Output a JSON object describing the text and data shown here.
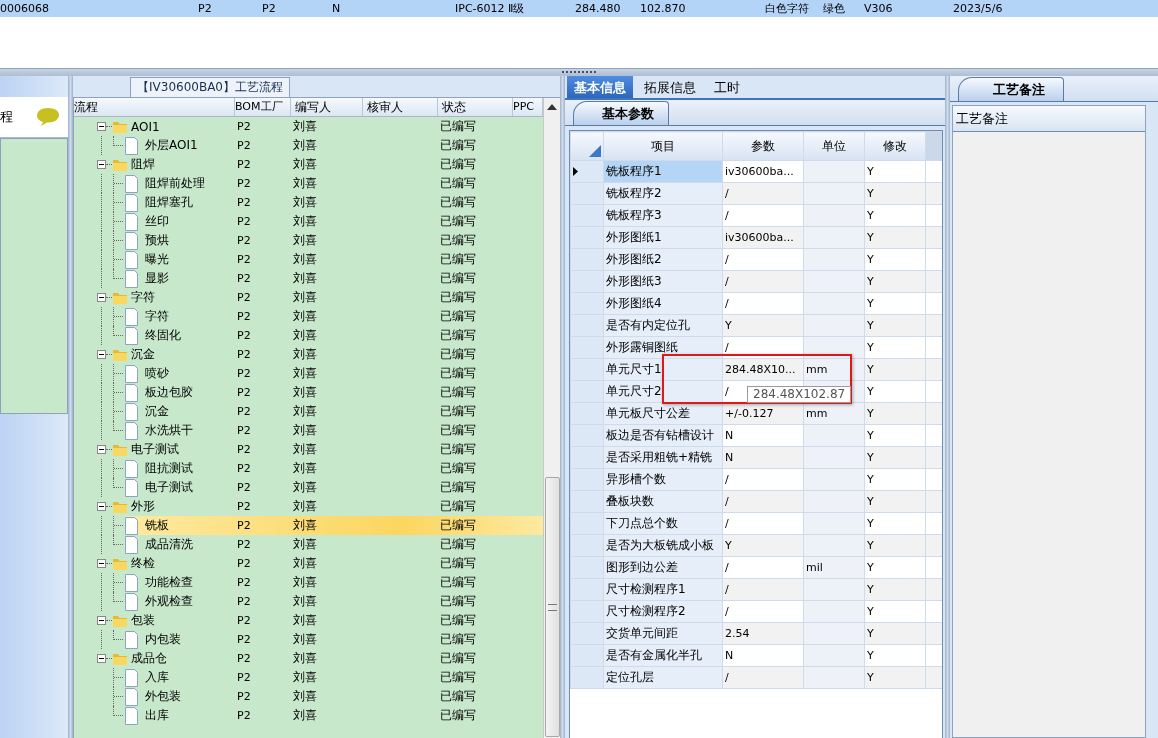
{
  "top_record": {
    "cells": [
      "0006068",
      "P2",
      "P2",
      "N",
      "IPC-6012 Ⅱ级",
      "284.480",
      "102.870",
      "白色字符",
      "绿色",
      "V306",
      "2023/5/6"
    ]
  },
  "side_panel": {
    "title": "程"
  },
  "process_tree": {
    "title": "【IV30600BA0】工艺流程",
    "columns": [
      "流程",
      "BOM工厂",
      "编写人",
      "核审人",
      "状态",
      "PPC"
    ],
    "rows": [
      {
        "name": "AOI1",
        "bom": "P2",
        "author": "刘喜",
        "status": "已编写",
        "expanded": true,
        "selected": false,
        "children": [
          {
            "name": "外层AOI1",
            "bom": "P2",
            "author": "刘喜",
            "status": "已编写",
            "selected": false
          }
        ]
      },
      {
        "name": "阻焊",
        "bom": "P2",
        "author": "刘喜",
        "status": "已编写",
        "expanded": true,
        "selected": false,
        "children": [
          {
            "name": "阻焊前处理",
            "bom": "P2",
            "author": "刘喜",
            "status": "已编写",
            "selected": false
          },
          {
            "name": "阻焊塞孔",
            "bom": "P2",
            "author": "刘喜",
            "status": "已编写",
            "selected": false
          },
          {
            "name": "丝印",
            "bom": "P2",
            "author": "刘喜",
            "status": "已编写",
            "selected": false
          },
          {
            "name": "预烘",
            "bom": "P2",
            "author": "刘喜",
            "status": "已编写",
            "selected": false
          },
          {
            "name": "曝光",
            "bom": "P2",
            "author": "刘喜",
            "status": "已编写",
            "selected": false
          },
          {
            "name": "显影",
            "bom": "P2",
            "author": "刘喜",
            "status": "已编写",
            "selected": false
          }
        ]
      },
      {
        "name": "字符",
        "bom": "P2",
        "author": "刘喜",
        "status": "已编写",
        "expanded": true,
        "selected": false,
        "children": [
          {
            "name": "字符",
            "bom": "P2",
            "author": "刘喜",
            "status": "已编写",
            "selected": false
          },
          {
            "name": "终固化",
            "bom": "P2",
            "author": "刘喜",
            "status": "已编写",
            "selected": false
          }
        ]
      },
      {
        "name": "沉金",
        "bom": "P2",
        "author": "刘喜",
        "status": "已编写",
        "expanded": true,
        "selected": false,
        "children": [
          {
            "name": "喷砂",
            "bom": "P2",
            "author": "刘喜",
            "status": "已编写",
            "selected": false
          },
          {
            "name": "板边包胶",
            "bom": "P2",
            "author": "刘喜",
            "status": "已编写",
            "selected": false
          },
          {
            "name": "沉金",
            "bom": "P2",
            "author": "刘喜",
            "status": "已编写",
            "selected": false
          },
          {
            "name": "水洗烘干",
            "bom": "P2",
            "author": "刘喜",
            "status": "已编写",
            "selected": false
          }
        ]
      },
      {
        "name": "电子测试",
        "bom": "P2",
        "author": "刘喜",
        "status": "已编写",
        "expanded": true,
        "selected": false,
        "children": [
          {
            "name": "阻抗测试",
            "bom": "P2",
            "author": "刘喜",
            "status": "已编写",
            "selected": false
          },
          {
            "name": "电子测试",
            "bom": "P2",
            "author": "刘喜",
            "status": "已编写",
            "selected": false
          }
        ]
      },
      {
        "name": "外形",
        "bom": "P2",
        "author": "刘喜",
        "status": "已编写",
        "expanded": true,
        "selected": false,
        "children": [
          {
            "name": "铣板",
            "bom": "P2",
            "author": "刘喜",
            "status": "已编写",
            "selected": true
          },
          {
            "name": "成品清洗",
            "bom": "P2",
            "author": "刘喜",
            "status": "已编写",
            "selected": false
          }
        ]
      },
      {
        "name": "终检",
        "bom": "P2",
        "author": "刘喜",
        "status": "已编写",
        "expanded": true,
        "selected": false,
        "children": [
          {
            "name": "功能检查",
            "bom": "P2",
            "author": "刘喜",
            "status": "已编写",
            "selected": false
          },
          {
            "name": "外观检查",
            "bom": "P2",
            "author": "刘喜",
            "status": "已编写",
            "selected": false
          }
        ]
      },
      {
        "name": "包装",
        "bom": "P2",
        "author": "刘喜",
        "status": "已编写",
        "expanded": true,
        "selected": false,
        "children": [
          {
            "name": "内包装",
            "bom": "P2",
            "author": "刘喜",
            "status": "已编写",
            "selected": false
          }
        ]
      },
      {
        "name": "成品仓",
        "bom": "P2",
        "author": "刘喜",
        "status": "已编写",
        "expanded": true,
        "selected": false,
        "children": [
          {
            "name": "入库",
            "bom": "P2",
            "author": "刘喜",
            "status": "已编写",
            "selected": false
          },
          {
            "name": "外包装",
            "bom": "P2",
            "author": "刘喜",
            "status": "已编写",
            "selected": false
          },
          {
            "name": "出库",
            "bom": "P2",
            "author": "刘喜",
            "status": "已编写",
            "selected": false
          }
        ]
      }
    ]
  },
  "main_tabs": [
    {
      "label": "基本信息",
      "selected": true
    },
    {
      "label": "拓展信息",
      "selected": false
    },
    {
      "label": "工时",
      "selected": false
    }
  ],
  "basic_params": {
    "tab": "基本参数",
    "columns": [
      "项目",
      "参数",
      "单位",
      "修改"
    ],
    "rows": [
      {
        "item": "铣板程序1",
        "value": "iv30600ba...",
        "modified": "Y",
        "selected": true
      },
      {
        "item": "铣板程序2",
        "value": "/",
        "modified": "Y",
        "selected": false
      },
      {
        "item": "铣板程序3",
        "value": "/",
        "modified": "Y",
        "selected": false
      },
      {
        "item": "外形图纸1",
        "value": "iv30600ba...",
        "modified": "Y",
        "selected": false
      },
      {
        "item": "外形图纸2",
        "value": "/",
        "modified": "Y",
        "selected": false
      },
      {
        "item": "外形图纸3",
        "value": "/",
        "modified": "Y",
        "selected": false
      },
      {
        "item": "外形图纸4",
        "value": "/",
        "modified": "Y",
        "selected": false
      },
      {
        "item": "是否有内定位孔",
        "value": "Y",
        "modified": "Y",
        "selected": false
      },
      {
        "item": "外形露铜图纸",
        "value": "/",
        "modified": "Y",
        "selected": false
      },
      {
        "item": "单元尺寸1",
        "value": "284.48X10...",
        "unit": "mm",
        "modified": "Y",
        "selected": false
      },
      {
        "item": "单元尺寸2",
        "value": "/",
        "modified": "Y",
        "selected": false
      },
      {
        "item": "单元板尺寸公差",
        "value": "+/-0.127",
        "unit": "mm",
        "modified": "Y",
        "selected": false
      },
      {
        "item": "板边是否有钻槽设计",
        "value": "N",
        "modified": "Y",
        "selected": false
      },
      {
        "item": "是否采用粗铣+精铣",
        "value": "N",
        "modified": "Y",
        "selected": false
      },
      {
        "item": "异形槽个数",
        "value": "/",
        "modified": "Y",
        "selected": false
      },
      {
        "item": "叠板块数",
        "value": "/",
        "modified": "Y",
        "selected": false
      },
      {
        "item": "下刀点总个数",
        "value": "/",
        "modified": "Y",
        "selected": false
      },
      {
        "item": "是否为大板铣成小板",
        "value": "Y",
        "modified": "Y",
        "selected": false
      },
      {
        "item": "图形到边公差",
        "value": "/",
        "unit": "mil",
        "modified": "Y",
        "selected": false
      },
      {
        "item": "尺寸检测程序1",
        "value": "/",
        "modified": "Y",
        "selected": false
      },
      {
        "item": "尺寸检测程序2",
        "value": "/",
        "modified": "Y",
        "selected": false
      },
      {
        "item": "交货单元间距",
        "value": "2.54",
        "modified": "Y",
        "selected": false
      },
      {
        "item": "是否有金属化半孔",
        "value": "N",
        "modified": "Y",
        "selected": false
      },
      {
        "item": "定位孔层",
        "value": "/",
        "modified": "Y",
        "selected": false
      }
    ]
  },
  "tooltip": {
    "text": "284.48X102.87"
  },
  "notes": {
    "tab": "工艺备注",
    "column": "工艺备注"
  }
}
